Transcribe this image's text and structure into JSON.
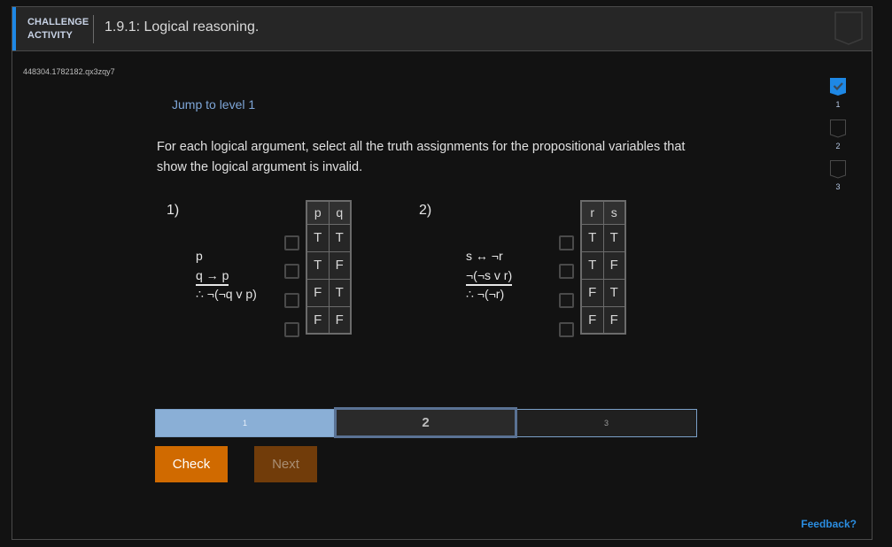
{
  "header": {
    "kind_line1": "CHALLENGE",
    "kind_line2": "ACTIVITY",
    "title": "1.9.1: Logical reasoning.",
    "badge_icon": "ribbon-badge-icon"
  },
  "activity_id": "448304.1782182.qx3zqy7",
  "jump_link": "Jump to level 1",
  "instructions": "For each logical argument, select all the truth assignments for the propositional variables that show the logical argument is invalid.",
  "questions": [
    {
      "number": "1)",
      "premises": [
        "p",
        "q → p"
      ],
      "conclusion": "∴ ¬(¬q v p)",
      "variables": [
        "p",
        "q"
      ],
      "rows": [
        [
          "T",
          "T"
        ],
        [
          "T",
          "F"
        ],
        [
          "F",
          "T"
        ],
        [
          "F",
          "F"
        ]
      ],
      "checked": [
        false,
        false,
        false,
        false
      ]
    },
    {
      "number": "2)",
      "premises": [
        "s ↔ ¬r",
        "¬(¬s v r)"
      ],
      "conclusion": "∴ ¬(¬r)",
      "variables": [
        "r",
        "s"
      ],
      "rows": [
        [
          "T",
          "T"
        ],
        [
          "T",
          "F"
        ],
        [
          "F",
          "T"
        ],
        [
          "F",
          "F"
        ]
      ],
      "checked": [
        false,
        false,
        false,
        false
      ]
    }
  ],
  "levels": {
    "items": [
      "1",
      "2",
      "3"
    ],
    "completed": [
      "1"
    ],
    "current": "2"
  },
  "buttons": {
    "check": "Check",
    "next": "Next"
  },
  "feedback": "Feedback?",
  "steps": [
    {
      "label": "1",
      "status": "complete",
      "icon": "checkmark-icon"
    },
    {
      "label": "2",
      "status": "incomplete"
    },
    {
      "label": "3",
      "status": "incomplete"
    }
  ],
  "colors": {
    "accent": "#1e88e5",
    "check_button": "#d06a00",
    "next_button_disabled": "#713c0a",
    "level_complete": "#8aafd6",
    "level_current_border": "#5a7294",
    "link": "#7ea6d8",
    "feedback": "#2b8de0"
  }
}
